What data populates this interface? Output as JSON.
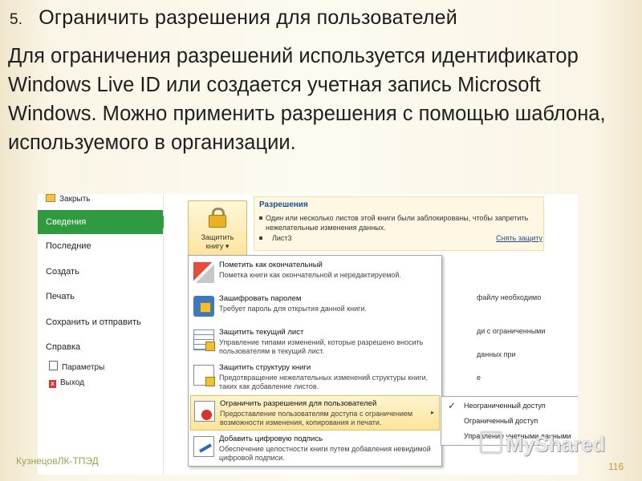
{
  "slide": {
    "number": "5.",
    "title": "Ограничить разрешения для пользователей",
    "body": "Для ограничения разрешений используется идентификатор Windows Live ID или создается учетная запись Microsoft Windows. Можно применить разрешения с помощью шаблона, используемого в организации.",
    "footer_left": "КузнецовЛК-ТПЭД",
    "page_number": "116",
    "watermark": "MyShared"
  },
  "sidebar": {
    "top_item": "Закрыть",
    "active_item": "Сведения",
    "items": [
      "Последние",
      "Создать",
      "Печать",
      "Сохранить и отправить",
      "Справка"
    ],
    "small_items": [
      "Параметры",
      "Выход"
    ]
  },
  "main": {
    "protect_button": {
      "line1": "Защитить",
      "line2": "книгу ▾"
    },
    "permissions": {
      "title": "Разрешения",
      "desc": "Один или несколько листов этой книги были заблокированы, чтобы запретить нежелательные изменения данных.",
      "sheet": "Лист3",
      "unprotect_link": "Снять защиту"
    },
    "background_fragments": [
      "файлу необходимо",
      "ди с ограниченными",
      "данных при",
      "е"
    ]
  },
  "dropdown": [
    {
      "title": "Пометить как окончательный",
      "desc": "Пометка книги как окончательной и нередактируемой.",
      "icon": "final-flag-icon"
    },
    {
      "title": "Зашифровать паролем",
      "desc": "Требует пароль для открытия данной книги.",
      "icon": "encrypt-lock-icon"
    },
    {
      "title": "Защитить текущий лист",
      "desc": "Управление типами изменений, которые разрешено вносить пользователям в текущий лист.",
      "icon": "sheet-protect-icon"
    },
    {
      "title": "Защитить структуру книги",
      "desc": "Предотвращение нежелательных изменений структуры книги, таких как добавление листов.",
      "icon": "workbook-structure-icon"
    },
    {
      "title": "Ограничить разрешения для пользователей",
      "desc": "Предоставление пользователям доступа с ограничением возможности изменения, копирования и печати.",
      "icon": "restrict-access-icon"
    },
    {
      "title": "Добавить цифровую подпись",
      "desc": "Обеспечение целостности книги путем добавления невидимой цифровой подписи.",
      "icon": "digital-signature-icon"
    }
  ],
  "submenu": [
    "Неограниченный доступ",
    "Ограниченный доступ",
    "Управление учетными данными"
  ]
}
